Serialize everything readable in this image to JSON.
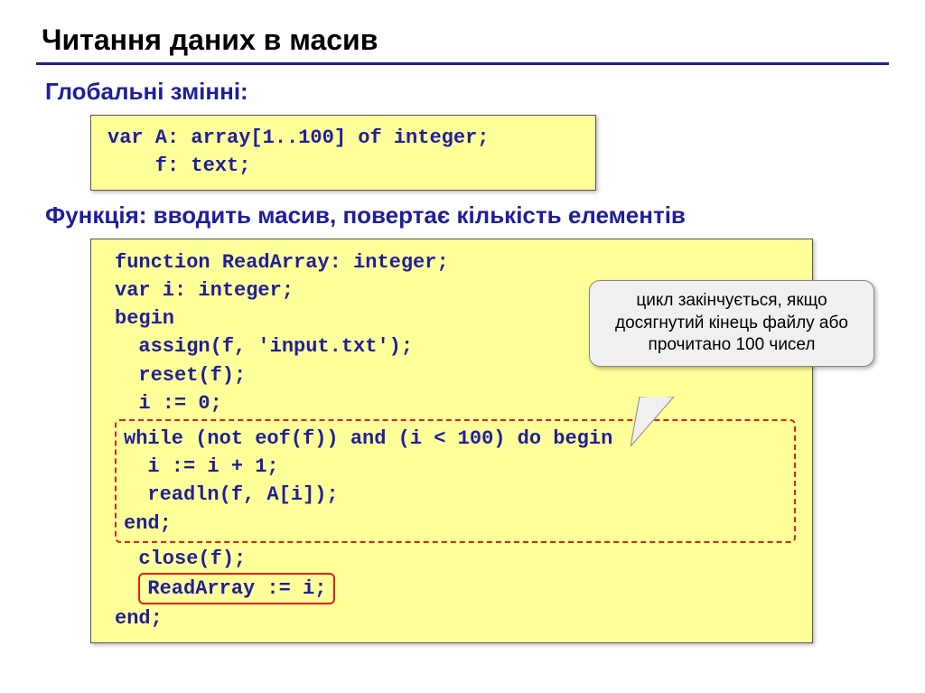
{
  "title": "Читання даних в масив",
  "sub1": "Глобальні змінні:",
  "code1": "var A: array[1..100] of integer;\n    f: text;",
  "sub2": "Функція: вводить масив, повертає кількість елементів",
  "code2_top": "function ReadArray: integer;\nvar i: integer;\nbegin\n  assign(f, 'input.txt');\n  reset(f);\n  i := 0;",
  "code2_loop": "while (not eof(f)) and (i < 100) do begin\n  i := i + 1;\n  readln(f, A[i]);\nend;",
  "code2_close": "  close(f);",
  "code2_ret": "ReadArray := i;",
  "code2_end": "end;",
  "callout": "цикл закінчується, якщо досягнутий кінець файлу або прочитано 100 чисел"
}
